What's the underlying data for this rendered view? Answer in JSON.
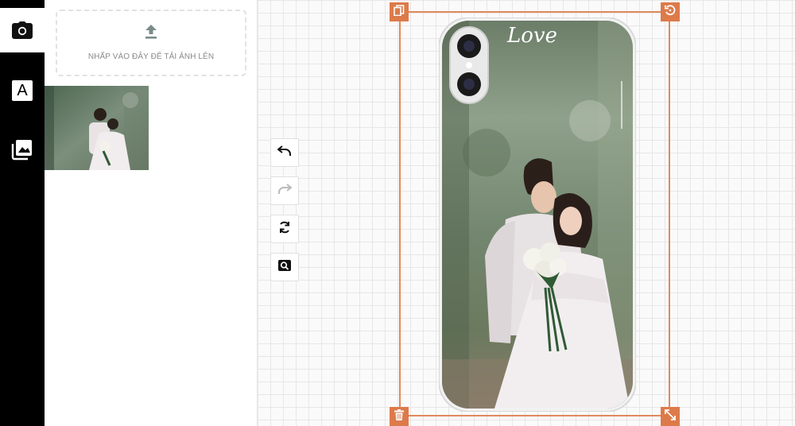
{
  "upload": {
    "label": "NHẤP VÀO ĐÂY ĐỂ TẢI ẢNH LÊN"
  },
  "toolbar": {
    "items": [
      {
        "name": "camera-icon"
      },
      {
        "name": "text-icon",
        "glyph": "A"
      },
      {
        "name": "images-icon"
      }
    ]
  },
  "canvas": {
    "phone_overlay_text": "Love",
    "controls": [
      "undo-icon",
      "redo-icon",
      "refresh-icon",
      "zoom-icon"
    ],
    "handles": [
      "copy-icon",
      "rotate-icon",
      "delete-icon",
      "resize-icon"
    ]
  },
  "colors": {
    "accent": "#dd7a4a",
    "toolbar_bg": "#000000"
  }
}
